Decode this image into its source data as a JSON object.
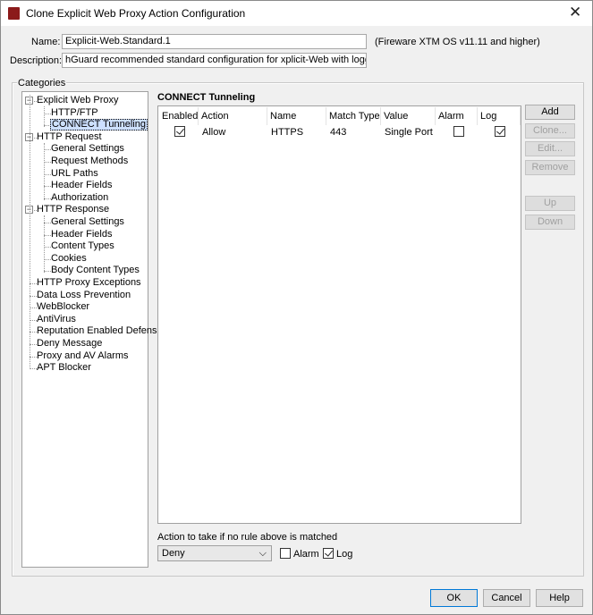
{
  "window": {
    "title": "Clone Explicit Web Proxy Action Configuration",
    "icon": "watchguard-app-icon"
  },
  "form": {
    "name_label": "Name:",
    "name_value": "Explicit-Web.Standard.1",
    "version_note": "(Fireware XTM OS v11.11 and higher)",
    "description_label": "Description:",
    "description_value": "hGuard recommended standard configuration for xplicit-Web with logging enabled"
  },
  "categories": {
    "label": "Categories",
    "items": [
      {
        "label": "Explicit Web Proxy",
        "level": 0,
        "expander": "minus"
      },
      {
        "label": "HTTP/FTP",
        "level": 1
      },
      {
        "label": "CONNECT Tunneling",
        "level": 1,
        "selected": true
      },
      {
        "label": "HTTP Request",
        "level": 0,
        "expander": "minus"
      },
      {
        "label": "General Settings",
        "level": 1
      },
      {
        "label": "Request Methods",
        "level": 1
      },
      {
        "label": "URL Paths",
        "level": 1
      },
      {
        "label": "Header Fields",
        "level": 1
      },
      {
        "label": "Authorization",
        "level": 1
      },
      {
        "label": "HTTP Response",
        "level": 0,
        "expander": "minus"
      },
      {
        "label": "General Settings",
        "level": 1
      },
      {
        "label": "Header Fields",
        "level": 1
      },
      {
        "label": "Content Types",
        "level": 1
      },
      {
        "label": "Cookies",
        "level": 1
      },
      {
        "label": "Body Content Types",
        "level": 1
      },
      {
        "label": "HTTP Proxy Exceptions",
        "level": 0
      },
      {
        "label": "Data Loss Prevention",
        "level": 0
      },
      {
        "label": "WebBlocker",
        "level": 0
      },
      {
        "label": "AntiVirus",
        "level": 0
      },
      {
        "label": "Reputation Enabled Defense",
        "level": 0
      },
      {
        "label": "Deny Message",
        "level": 0
      },
      {
        "label": "Proxy and AV Alarms",
        "level": 0
      },
      {
        "label": "APT Blocker",
        "level": 0
      }
    ]
  },
  "panel": {
    "title": "CONNECT Tunneling",
    "columns": [
      "Enabled",
      "Action",
      "Name",
      "Match Type",
      "Value",
      "Alarm",
      "Log"
    ],
    "rows": [
      {
        "enabled": true,
        "action": "Allow",
        "name": "HTTPS",
        "match_type": "443",
        "value": "Single Port",
        "alarm": false,
        "log": true
      }
    ],
    "buttons": [
      {
        "label": "Add",
        "enabled": true
      },
      {
        "label": "Clone...",
        "enabled": false
      },
      {
        "label": "Edit...",
        "enabled": false
      },
      {
        "label": "Remove",
        "enabled": false
      },
      {
        "label": "Up",
        "enabled": false
      },
      {
        "label": "Down",
        "enabled": false
      }
    ],
    "default_action_label": "Action to take if no rule above is matched",
    "default_action_value": "Deny",
    "alarm_label": "Alarm",
    "alarm_checked": false,
    "log_label": "Log",
    "log_checked": true
  },
  "footer": {
    "ok": "OK",
    "cancel": "Cancel",
    "help": "Help"
  }
}
